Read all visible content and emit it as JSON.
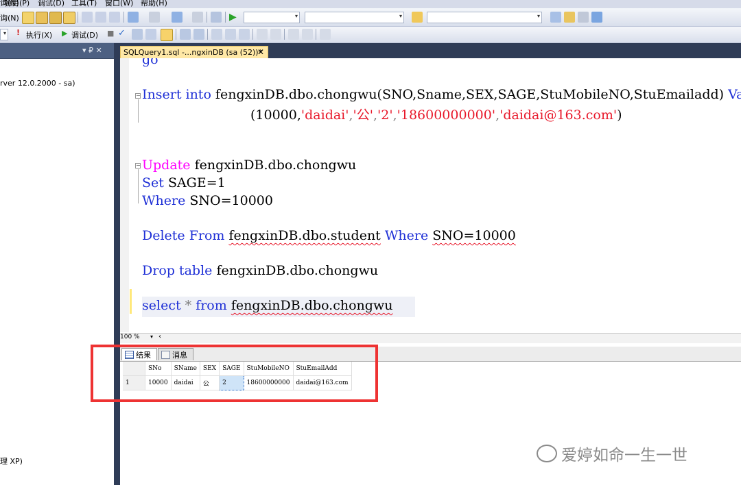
{
  "menu": {
    "items": [
      "询(N)",
      "项目(P)",
      "调试(D)",
      "工具(T)",
      "窗口(W)",
      "帮助(H)"
    ]
  },
  "toolbar2": {
    "execute_label": "执行(X)",
    "debug_label": "调试(D)"
  },
  "object_explorer": {
    "server_node": "rver 12.0.2000 - sa)",
    "bottom_node": "理 XP)",
    "pin_glyph": "▾ ₽ ✕"
  },
  "editor_tab": {
    "title": "SQLQuery1.sql -...ngxinDB (sa (52))*",
    "close": "✕"
  },
  "code": {
    "go_fragment": "go",
    "insert_kw": "Insert into",
    "insert_rest": " fengxinDB.dbo.chongwu(SNO,Sname,SEX,SAGE,StuMobileNO,StuEmailadd) ",
    "insert_values_kw": "Va",
    "values_open": "(10000,",
    "val_name": "'daidai'",
    "comma1": ",",
    "val_sex": "'公'",
    "comma2": ",",
    "val_age": "'2'",
    "comma3": ",",
    "val_mobile": "'18600000000'",
    "comma4": ",",
    "val_email": "'daidai@163.com'",
    "values_close": ")",
    "update_kw": "Update",
    "update_rest": " fengxinDB.dbo.chongwu",
    "set_kw": "Set",
    "set_rest": " SAGE=1",
    "where_kw": "Where",
    "where_rest": " SNO=10000",
    "delete_kw": "Delete From",
    "delete_table": "fengxinDB.dbo.student",
    "delete_where_kw": "Where",
    "delete_cond": "SNO=10000",
    "drop_kw": "Drop table",
    "drop_rest": " fengxinDB.dbo.chongwu",
    "select_kw": "select",
    "select_star": "*",
    "select_from_kw": "from",
    "select_table": "fengxinDB.dbo.chongwu"
  },
  "zoom": {
    "level": "100 %"
  },
  "results": {
    "tab_results": "结果",
    "tab_messages": "消息",
    "columns": [
      "SNo",
      "SName",
      "SEX",
      "SAGE",
      "StuMobileNO",
      "StuEmailAdd"
    ],
    "rows": [
      {
        "rownum": "1",
        "cells": [
          "10000",
          "daidai",
          "公",
          "2",
          "18600000000",
          "daidai@163.com"
        ]
      }
    ]
  },
  "watermark": {
    "text": "爱婷如命一生一世"
  },
  "colors": {
    "keyword": "#1e2fd6",
    "dml_keyword": "#ff00ff",
    "string": "#e8182a",
    "highlight_box": "#ee3333",
    "dark_chrome": "#2f3c57"
  }
}
